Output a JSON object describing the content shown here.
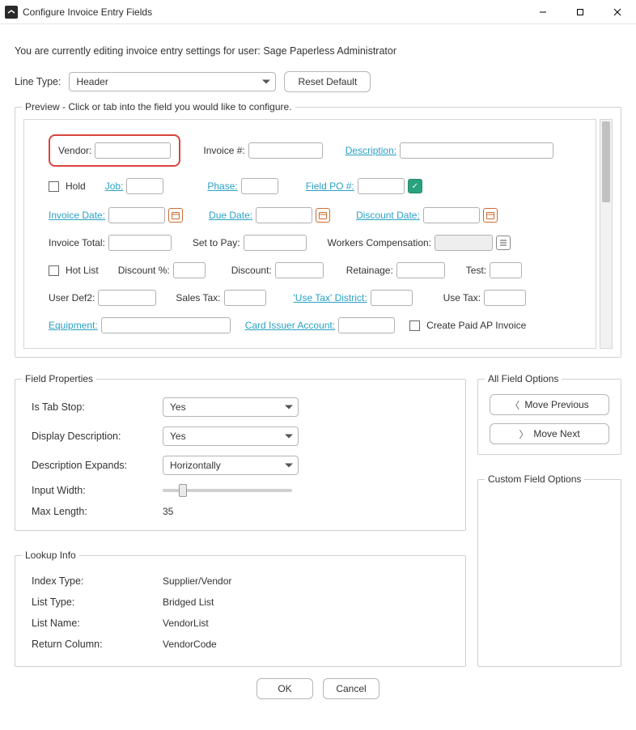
{
  "titlebar": {
    "title": "Configure Invoice Entry Fields"
  },
  "message": "You are currently editing invoice entry settings for user: Sage Paperless Administrator",
  "lineType": {
    "label": "Line Type:",
    "value": "Header"
  },
  "resetDefault": "Reset Default",
  "preview": {
    "legend": "Preview - Click or tab into the field you would like to configure.",
    "vendor": "Vendor:",
    "invoiceNum": "Invoice #:",
    "description": "Description:",
    "hold": "Hold",
    "job": "Job:",
    "phase": "Phase:",
    "fieldPO": "Field PO #:",
    "invoiceDate": "Invoice Date:",
    "dueDate": "Due Date:",
    "discountDate": "Discount Date:",
    "invoiceTotal": "Invoice Total:",
    "setToPay": "Set to Pay:",
    "workersComp": "Workers Compensation:",
    "hotList": "Hot List",
    "discountPct": "Discount %:",
    "discount": "Discount:",
    "retainage": "Retainage:",
    "test": "Test:",
    "userDef2": "User Def2:",
    "salesTax": "Sales Tax:",
    "useTaxDistrict": "'Use Tax' District:",
    "useTax": "Use Tax:",
    "equipment": "Equipment:",
    "cardIssuer": "Card Issuer Account:",
    "createPaidAP": "Create Paid AP Invoice"
  },
  "fieldProps": {
    "legend": "Field Properties",
    "isTabStop": {
      "label": "Is Tab Stop:",
      "value": "Yes"
    },
    "displayDesc": {
      "label": "Display Description:",
      "value": "Yes"
    },
    "descExpands": {
      "label": "Description Expands:",
      "value": "Horizontally"
    },
    "inputWidth": {
      "label": "Input Width:"
    },
    "maxLength": {
      "label": "Max Length:",
      "value": "35"
    }
  },
  "allFieldOptions": {
    "legend": "All Field Options",
    "movePrev": "Move Previous",
    "moveNext": "Move Next"
  },
  "customFieldOptions": {
    "legend": "Custom Field Options"
  },
  "lookup": {
    "legend": "Lookup Info",
    "indexType": {
      "label": "Index Type:",
      "value": "Supplier/Vendor"
    },
    "listType": {
      "label": "List Type:",
      "value": "Bridged List"
    },
    "listName": {
      "label": "List Name:",
      "value": "VendorList"
    },
    "returnCol": {
      "label": "Return Column:",
      "value": "VendorCode"
    }
  },
  "footer": {
    "ok": "OK",
    "cancel": "Cancel"
  }
}
